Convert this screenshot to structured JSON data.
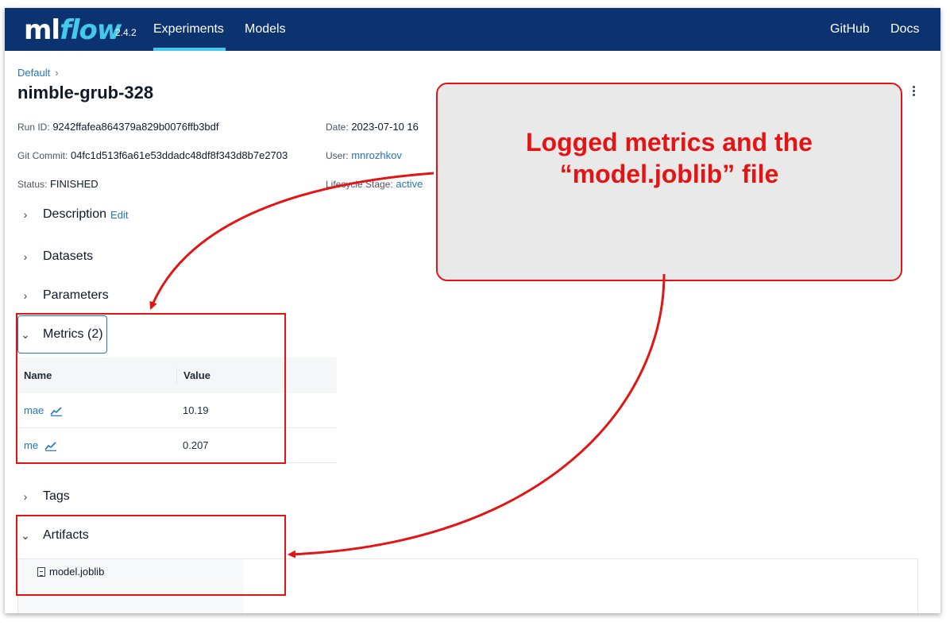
{
  "app": {
    "logo_ml": "ml",
    "logo_flow": "flow",
    "version": "2.4.2"
  },
  "nav": {
    "experiments": "Experiments",
    "models": "Models",
    "github": "GitHub",
    "docs": "Docs"
  },
  "breadcrumb": {
    "label": "Default",
    "separator": "›"
  },
  "run": {
    "title": "nimble-grub-328",
    "run_id_label": "Run ID:",
    "run_id": "9242ffafea864379a829b0076ffb3bdf",
    "date_label": "Date:",
    "date": "2023-07-10 16",
    "git_label": "Git Commit:",
    "git_commit": "04fc1d513f6a61e53ddadc48df8f343d8b7e2703",
    "user_label": "User:",
    "user": "mnrozhkov",
    "status_label": "Status:",
    "status": "FINISHED",
    "lifecycle_label": "Lifecycle Stage:",
    "lifecycle": "active"
  },
  "sections": {
    "description": "Description",
    "edit": "Edit",
    "datasets": "Datasets",
    "parameters": "Parameters",
    "metrics": "Metrics (2)",
    "tags": "Tags",
    "artifacts": "Artifacts"
  },
  "metrics_table": {
    "headers": [
      "Name",
      "Value"
    ],
    "rows": [
      {
        "name": "mae",
        "value": "10.19"
      },
      {
        "name": "me",
        "value": "0.207"
      }
    ]
  },
  "artifacts": {
    "files": [
      "model.joblib"
    ]
  },
  "annotation": {
    "line1": "Logged metrics and the",
    "line2": "“model.joblib” file",
    "color": "#e41414"
  },
  "colors": {
    "header_bg": "#0a3370",
    "accent": "#43c9ed",
    "link": "#2374bb"
  }
}
